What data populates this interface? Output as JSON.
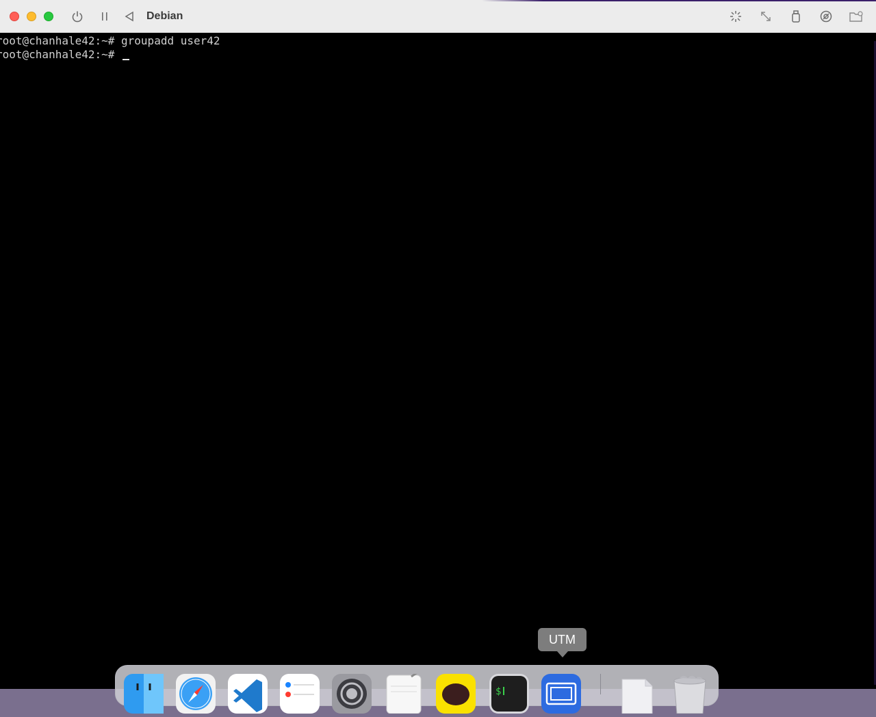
{
  "window": {
    "title": "Debian"
  },
  "terminal": {
    "lines": [
      "root@chanhale42:~# groupadd user42",
      "root@chanhale42:~# "
    ]
  },
  "dock": {
    "tooltip": "UTM",
    "items": [
      {
        "name": "finder",
        "color": "#2f9bf0"
      },
      {
        "name": "safari",
        "color": "#3aa0f5"
      },
      {
        "name": "vscode",
        "color": "#ffffff"
      },
      {
        "name": "reminders",
        "color": "#ffffff"
      },
      {
        "name": "system-settings",
        "color": "#9a9aa0"
      },
      {
        "name": "textedit",
        "color": "#f5f5f5"
      },
      {
        "name": "kakaotalk",
        "color": "#fae100"
      },
      {
        "name": "terminal",
        "color": "#2b2b2b"
      },
      {
        "name": "utm",
        "color": "#2d6be0"
      },
      {
        "name": "downloads-folder",
        "color": "#e9e9ee"
      },
      {
        "name": "trash",
        "color": "#d9d9dd"
      }
    ]
  }
}
